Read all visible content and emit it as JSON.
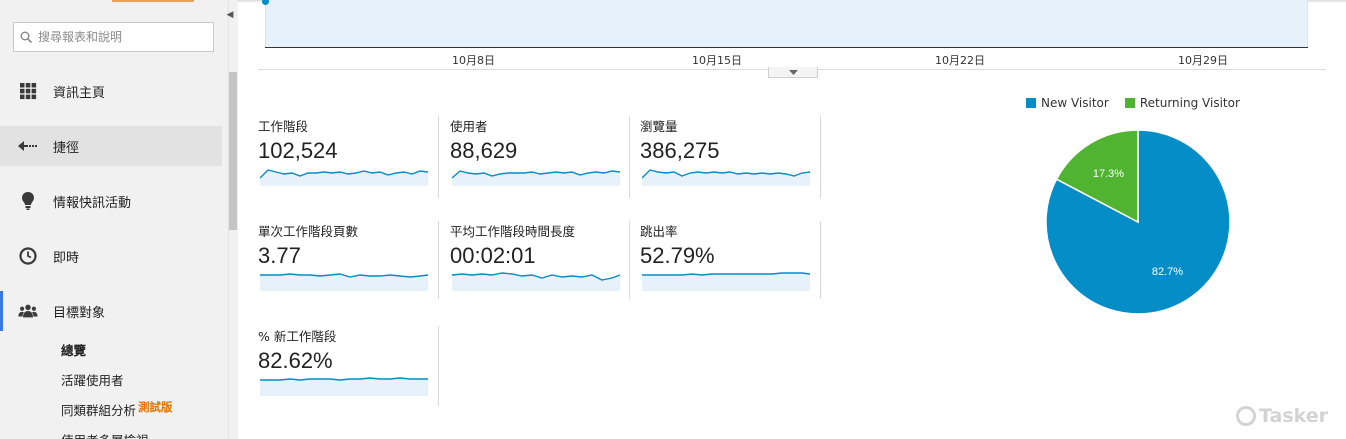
{
  "sidebar": {
    "search_placeholder": "搜尋報表和說明",
    "nav": [
      {
        "label": "資訊主頁",
        "icon": "dashboard-grid-icon"
      },
      {
        "label": "捷徑",
        "icon": "shortcut-arrow-icon"
      },
      {
        "label": "情報快訊活動",
        "icon": "lightbulb-icon"
      },
      {
        "label": "即時",
        "icon": "clock-icon"
      },
      {
        "label": "目標對象",
        "icon": "people-icon"
      }
    ],
    "sub_items": [
      {
        "label": "總覽"
      },
      {
        "label": "活躍使用者"
      },
      {
        "label": "同類群組分析",
        "badge": "測試版"
      },
      {
        "label": "使用者多層檢視"
      }
    ]
  },
  "timeline": {
    "date_ticks": [
      "10月8日",
      "10月15日",
      "10月22日",
      "10月29日"
    ],
    "area_color": "#e6f1f9",
    "line_color": "#058dc7"
  },
  "metrics": [
    {
      "label": "工作階段",
      "value": "102,524"
    },
    {
      "label": "使用者",
      "value": "88,629"
    },
    {
      "label": "瀏覽量",
      "value": "386,275"
    },
    {
      "label": "單次工作階段頁數",
      "value": "3.77"
    },
    {
      "label": "平均工作階段時間長度",
      "value": "00:02:01"
    },
    {
      "label": "跳出率",
      "value": "52.79%"
    },
    {
      "label": "% 新工作階段",
      "value": "82.62%"
    }
  ],
  "chart_data": {
    "type": "pie",
    "legend_position": "top",
    "slices": [
      {
        "name": "New Visitor",
        "value": 82.7,
        "label": "82.7%",
        "color": "#058dc7"
      },
      {
        "name": "Returning Visitor",
        "value": 17.3,
        "label": "17.3%",
        "color": "#50b432"
      }
    ]
  },
  "watermark": {
    "text": "Tasker"
  }
}
